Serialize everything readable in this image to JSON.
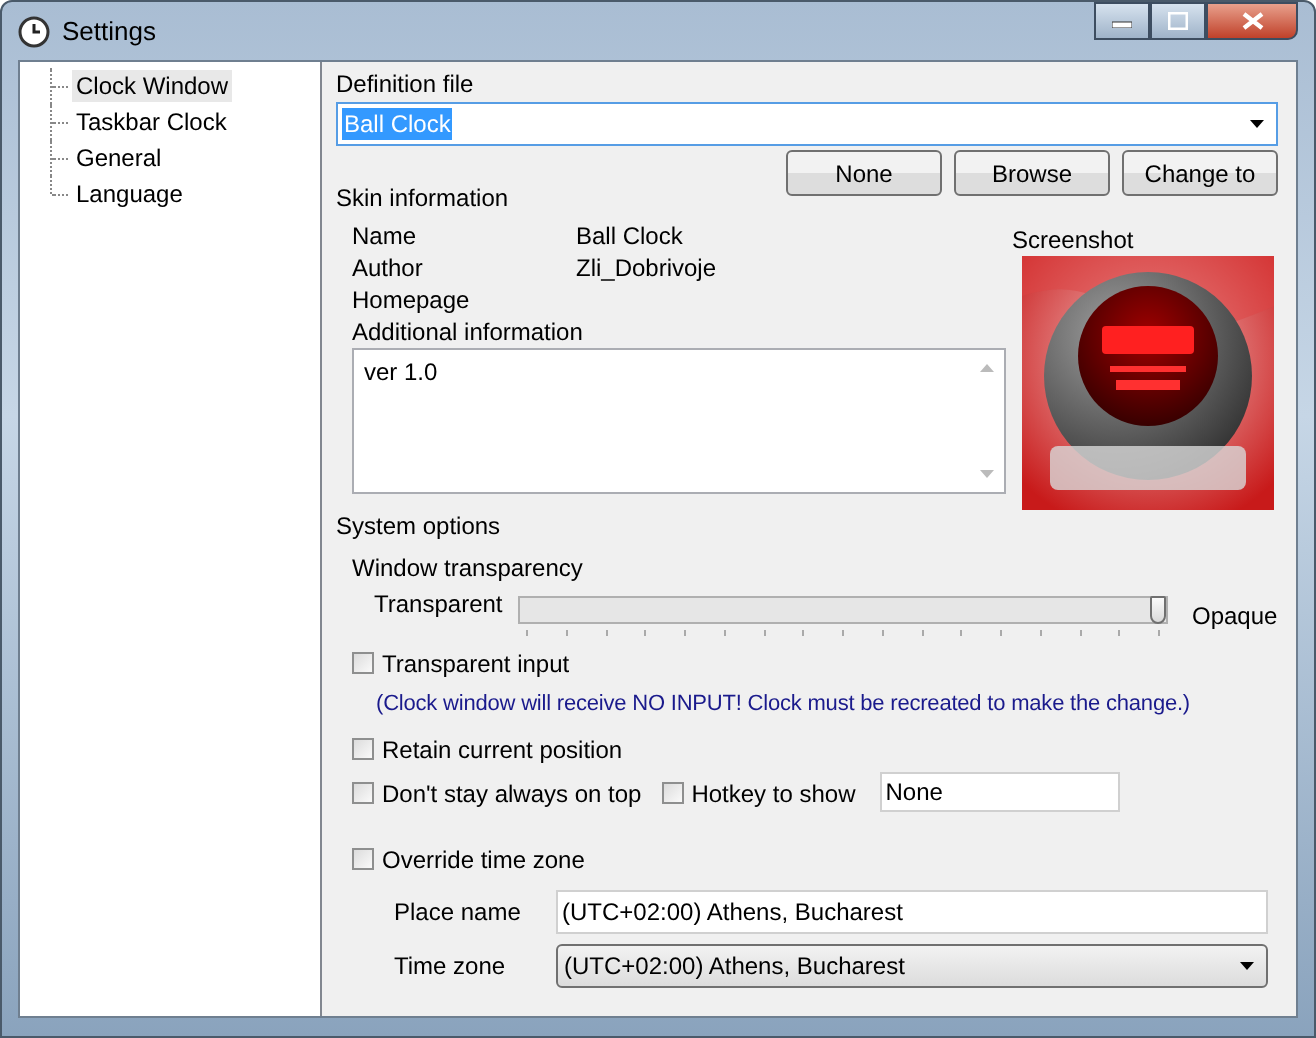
{
  "window": {
    "title": "Settings"
  },
  "tree": {
    "items": [
      {
        "label": "Clock Window",
        "selected": true
      },
      {
        "label": "Taskbar Clock",
        "selected": false
      },
      {
        "label": "General",
        "selected": false
      },
      {
        "label": "Language",
        "selected": false
      }
    ]
  },
  "definition_file": {
    "label": "Definition file",
    "value": "Ball Clock",
    "text_selected": true
  },
  "buttons": [
    "None",
    "Browse",
    "Change to"
  ],
  "skin_information": {
    "heading": "Skin information",
    "fields": [
      {
        "label": "Name",
        "value": "Ball Clock"
      },
      {
        "label": "Author",
        "value": "Zli_Dobrivoje"
      },
      {
        "label": "Homepage"
      }
    ],
    "additional_label": "Additional information",
    "additional_text": "ver 1.0"
  },
  "screenshot": {
    "label": "Screenshot",
    "kind": "picture"
  },
  "system_options": {
    "heading": "System options",
    "transparency_label": "Window transparency",
    "min_label": "Transparent",
    "max_label": "Opaque",
    "level": 1
  },
  "checkbox_rows": [
    {
      "kind": "checkbox",
      "label": "Transparent input",
      "checked": false
    },
    {
      "kind": "note",
      "text": "(Clock window will receive NO INPUT! Clock must be recreated to make the change.)"
    },
    {
      "kind": "checkbox",
      "label": "Retain current position",
      "checked": false
    },
    {
      "kind": "pair",
      "label": "Don't stay always on top",
      "checked": false,
      "hotkey_label": "Hotkey to show",
      "hotkey_checked": false,
      "hotkey_value": "None"
    },
    {
      "kind": "checkbox",
      "label": "Override time zone",
      "checked": false
    }
  ],
  "time_zone": {
    "place_label": "Place name",
    "place_value": "(UTC+02:00) Athens, Bucharest",
    "zone_label": "Time zone",
    "zone_value": "(UTC+02:00) Athens, Bucharest"
  }
}
